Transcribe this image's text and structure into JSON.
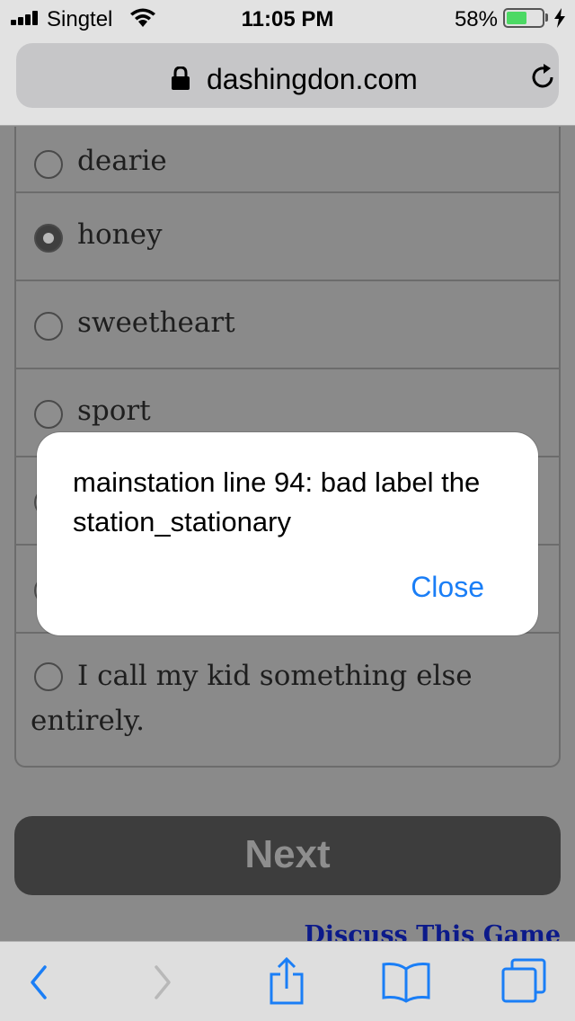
{
  "status_bar": {
    "carrier": "Singtel",
    "time": "11:05 PM",
    "battery_percent": "58%",
    "battery_level": 0.58,
    "icons": [
      "signal-icon",
      "wifi-icon",
      "battery-icon",
      "charging-bolt-icon"
    ]
  },
  "browser": {
    "url": "dashingdon.com",
    "icons": [
      "lock-icon",
      "reload-icon"
    ]
  },
  "options": [
    {
      "label": "dearie",
      "checked": false
    },
    {
      "label": "honey",
      "checked": true
    },
    {
      "label": "sweetheart",
      "checked": false
    },
    {
      "label": "sport",
      "checked": false
    },
    {
      "label": "",
      "checked": false
    },
    {
      "label": "",
      "checked": false
    },
    {
      "label": "I call my kid something else entirely.",
      "checked": false
    }
  ],
  "next_label": "Next",
  "discuss_link": "Discuss This Game",
  "dialog": {
    "message": "mainstation line 94: bad label the station_stationary",
    "close_label": "Close"
  },
  "toolbar": {
    "icons": [
      "back-icon",
      "forward-icon",
      "share-icon",
      "bookmarks-icon",
      "tabs-icon"
    ]
  },
  "colors": {
    "overlay_background": "#8a8a8a",
    "link_blue": "#1a7ef6",
    "battery_green": "#4cd964"
  }
}
